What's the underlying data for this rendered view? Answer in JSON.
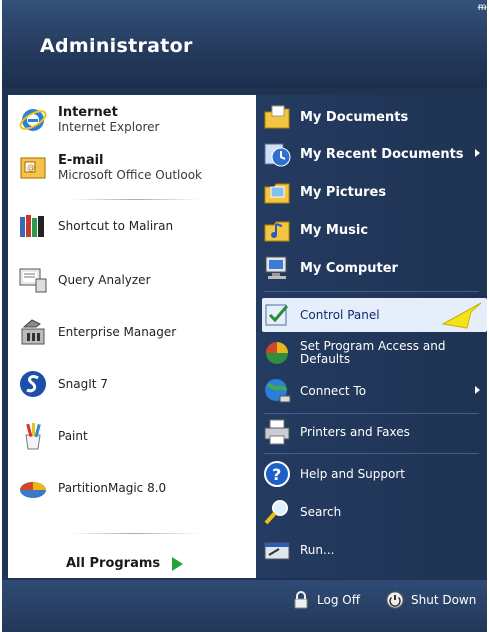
{
  "header": {
    "user_name": "Administrator",
    "corner_mark": "ᵯ"
  },
  "left_pane": {
    "pinned": [
      {
        "title": "Internet",
        "subtitle": "Internet Explorer",
        "icon": "internet-explorer-icon"
      },
      {
        "title": "E-mail",
        "subtitle": "Microsoft Office Outlook",
        "icon": "outlook-icon"
      }
    ],
    "recent": [
      {
        "label": "Shortcut to Maliran",
        "icon": "books-icon"
      },
      {
        "label": "Query Analyzer",
        "icon": "query-analyzer-icon"
      },
      {
        "label": "Enterprise Manager",
        "icon": "enterprise-manager-icon"
      },
      {
        "label": "SnagIt 7",
        "icon": "snagit-icon"
      },
      {
        "label": "Paint",
        "icon": "paint-icon"
      },
      {
        "label": "PartitionMagic 8.0",
        "icon": "partitionmagic-icon"
      }
    ],
    "all_programs": "All Programs"
  },
  "right_pane": {
    "items": [
      {
        "label": "My Documents",
        "icon": "my-documents-icon"
      },
      {
        "label": "My Recent Documents",
        "icon": "recent-documents-icon",
        "submenu": true
      },
      {
        "label": "My Pictures",
        "icon": "my-pictures-icon"
      },
      {
        "label": "My Music",
        "icon": "my-music-icon"
      },
      {
        "label": "My Computer",
        "icon": "my-computer-icon"
      },
      {
        "label": "Control Panel",
        "icon": "control-panel-icon",
        "highlighted": true
      },
      {
        "label": "Set Program Access and Defaults",
        "icon": "program-access-icon"
      },
      {
        "label": "Connect To",
        "icon": "connect-to-icon",
        "submenu": true
      },
      {
        "label": "Printers and Faxes",
        "icon": "printers-icon"
      },
      {
        "label": "Help and Support",
        "icon": "help-icon"
      },
      {
        "label": "Search",
        "icon": "search-icon"
      },
      {
        "label": "Run...",
        "icon": "run-icon"
      }
    ]
  },
  "footer": {
    "log_off": "Log Off",
    "shut_down": "Shut Down"
  },
  "colors": {
    "menu_blue": "#1f3352",
    "highlight": "#e7eefb",
    "arrow_yellow": "#f5e21a",
    "all_programs_arrow": "#22a33a"
  }
}
